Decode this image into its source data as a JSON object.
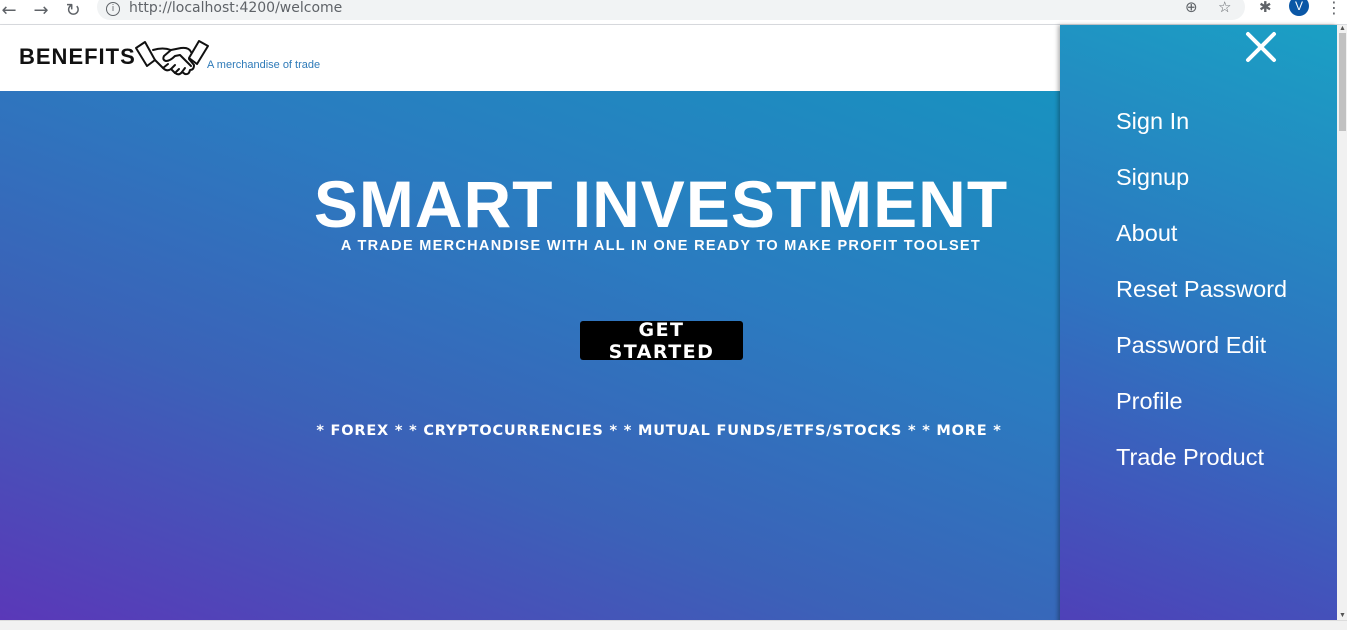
{
  "browser": {
    "url": "http://localhost:4200/welcome",
    "back_icon": "←",
    "forward_icon": "→",
    "reload_icon": "↻",
    "info_icon": "i",
    "zoom_icon": "⊕",
    "star_icon": "☆",
    "extensions_icon": "✱",
    "profile_initial": "V",
    "menu_icon": "⋮"
  },
  "header": {
    "brand": "BENEFITS",
    "tagline": "A merchandise of trade"
  },
  "hero": {
    "title": "SMART INVESTMENT",
    "subtitle": "A TRADE MERCHANDISE WITH ALL IN ONE READY TO MAKE PROFIT TOOLSET",
    "cta_label": "GET STARTED",
    "markets": "* FOREX * * CRYPTOCURRENCIES * * MUTUAL FUNDS/ETFS/STOCKS * * MORE *"
  },
  "sidenav": {
    "items": [
      {
        "label": "Sign In"
      },
      {
        "label": "Signup"
      },
      {
        "label": "About"
      },
      {
        "label": "Reset Password"
      },
      {
        "label": "Password Edit"
      },
      {
        "label": "Profile"
      },
      {
        "label": "Trade Product"
      }
    ]
  },
  "colors": {
    "hero_gradient_start": "#5a38b8",
    "hero_gradient_end": "#1892c0",
    "tagline": "#2e7ab8",
    "cta_background": "#000000"
  }
}
